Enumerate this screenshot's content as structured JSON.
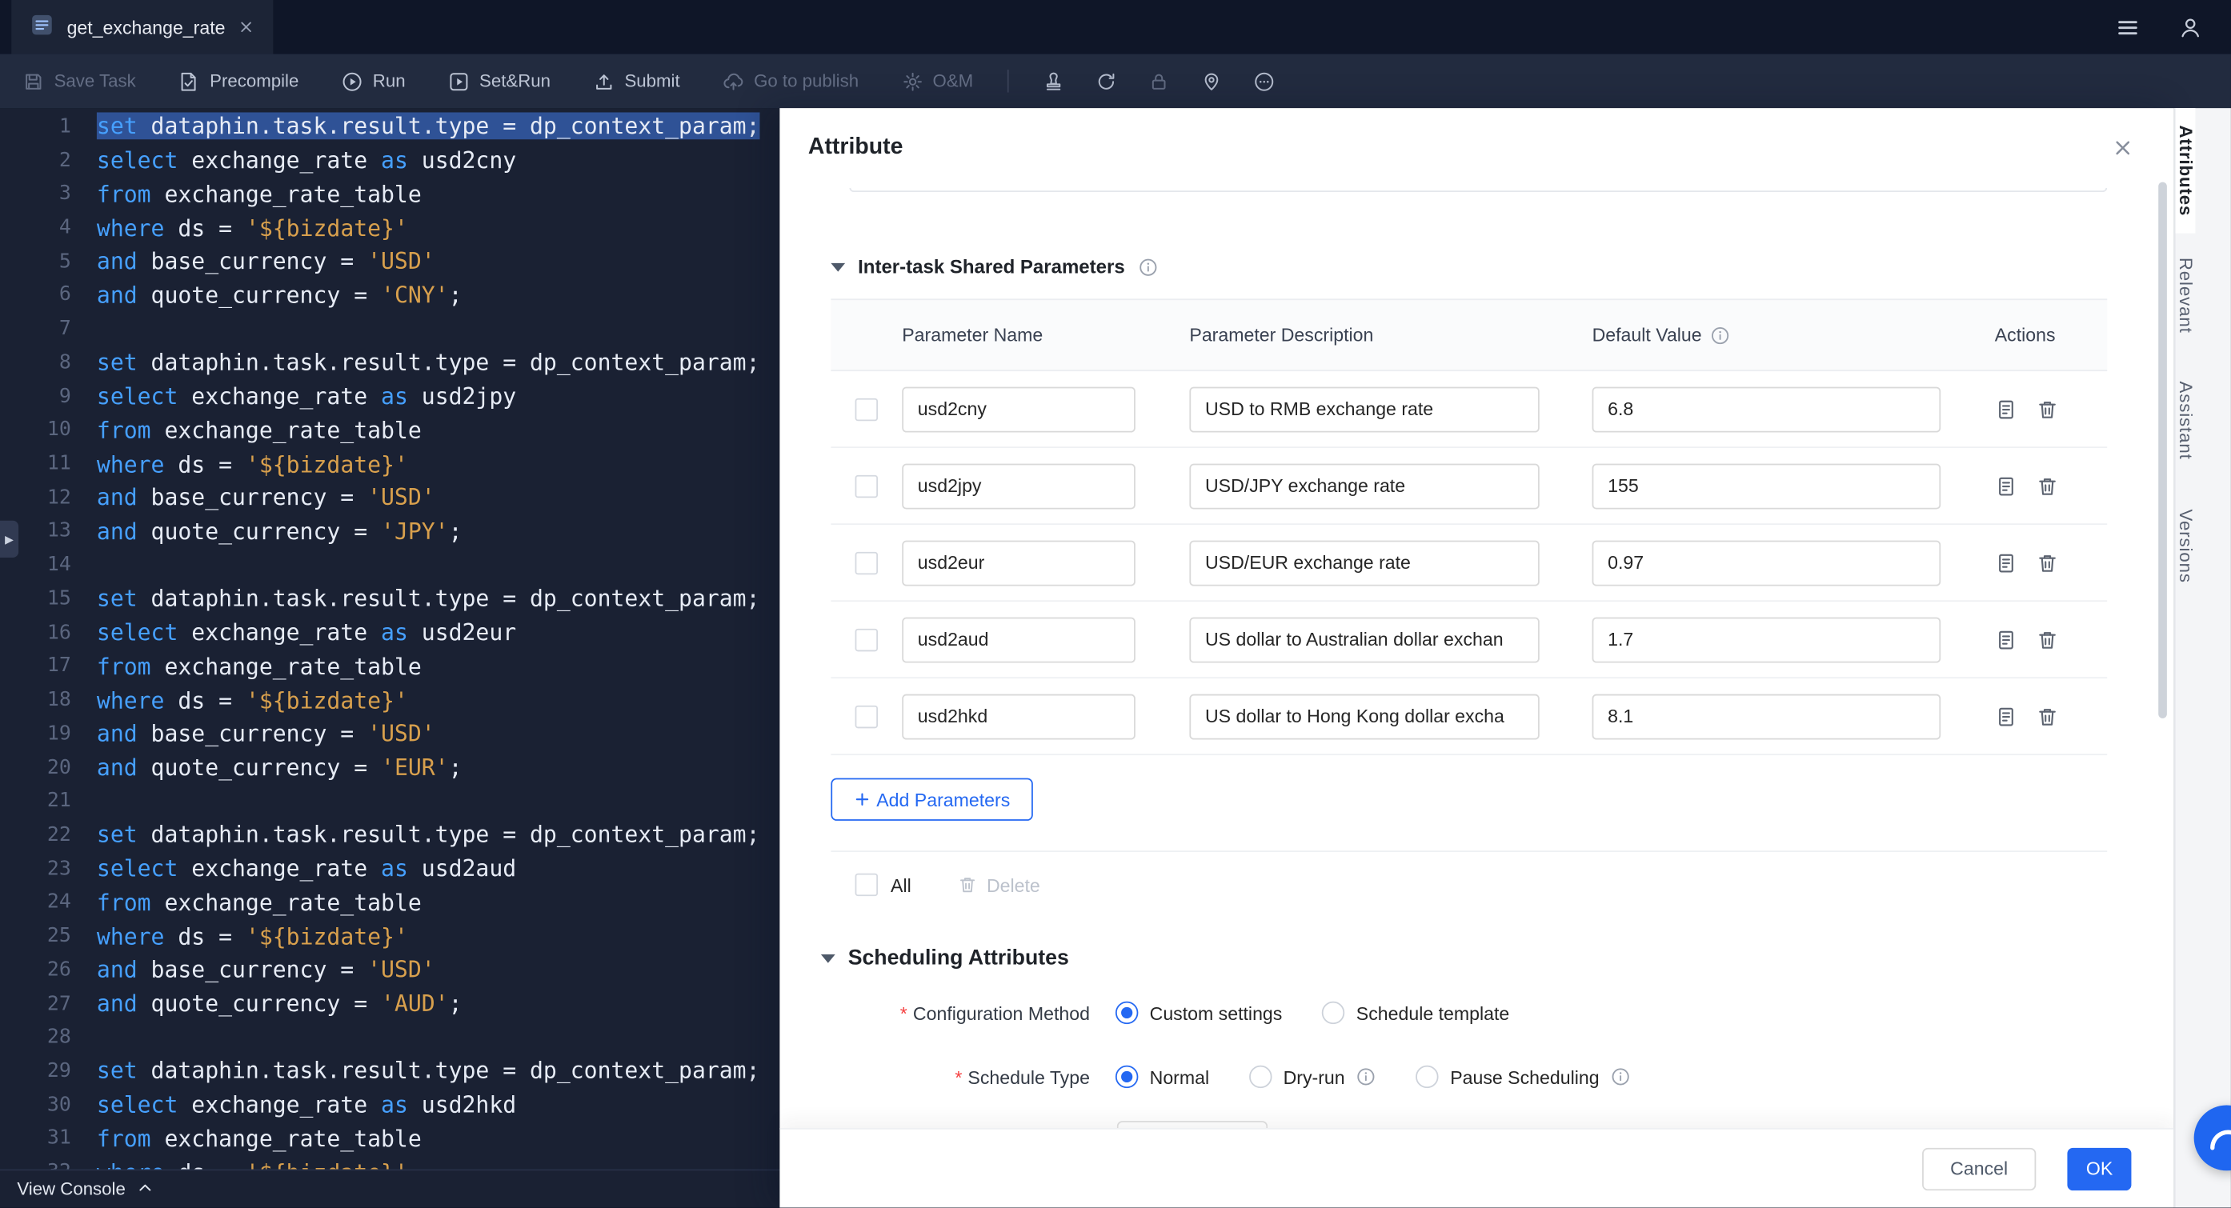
{
  "colors": {
    "accent_blue": "#2468f2",
    "editor_bg": "#1a2133",
    "keyword": "#46a0ff",
    "string": "#d8a04d",
    "selection": "#2f5296",
    "danger": "#f53f3f"
  },
  "tab_bar": {
    "active_tab": "get_exchange_rate"
  },
  "toolbar": {
    "actions": [
      {
        "label": "Save Task",
        "icon": "save-icon",
        "disabled": true
      },
      {
        "label": "Precompile",
        "icon": "precompile-icon",
        "disabled": false
      },
      {
        "label": "Run",
        "icon": "run-icon",
        "disabled": false
      },
      {
        "label": "Set&Run",
        "icon": "set-run-icon",
        "disabled": false
      },
      {
        "label": "Submit",
        "icon": "submit-icon",
        "disabled": false
      },
      {
        "label": "Go to publish",
        "icon": "publish-icon",
        "disabled": true
      },
      {
        "label": "O&M",
        "icon": "om-icon",
        "disabled": true
      }
    ],
    "icon_buttons": [
      {
        "icon": "stamp-icon",
        "disabled": false
      },
      {
        "icon": "refresh-icon",
        "disabled": false
      },
      {
        "icon": "lock-icon",
        "disabled": true
      },
      {
        "icon": "location-icon",
        "disabled": false
      },
      {
        "icon": "more-icon",
        "disabled": false
      }
    ]
  },
  "editor": {
    "console_label": "View Console",
    "lines": [
      {
        "sel": true,
        "t": [
          [
            "k",
            "set "
          ],
          [
            "p",
            "dataphin.task.result.type = dp_context_param;"
          ]
        ]
      },
      {
        "t": [
          [
            "k",
            "select "
          ],
          [
            "p",
            "exchange_rate "
          ],
          [
            "k",
            "as "
          ],
          [
            "p",
            "usd2cny"
          ]
        ]
      },
      {
        "t": [
          [
            "k",
            "from "
          ],
          [
            "p",
            "exchange_rate_table"
          ]
        ]
      },
      {
        "t": [
          [
            "k",
            "where "
          ],
          [
            "p",
            "ds = "
          ],
          [
            "s",
            "'${bizdate}'"
          ]
        ]
      },
      {
        "t": [
          [
            "k",
            "and "
          ],
          [
            "p",
            "base_currency = "
          ],
          [
            "s",
            "'USD'"
          ]
        ]
      },
      {
        "t": [
          [
            "k",
            "and "
          ],
          [
            "p",
            "quote_currency = "
          ],
          [
            "s",
            "'CNY'"
          ],
          [
            "p",
            ";"
          ]
        ]
      },
      {
        "t": []
      },
      {
        "t": [
          [
            "k",
            "set "
          ],
          [
            "p",
            "dataphin.task.result.type = dp_context_param;"
          ]
        ]
      },
      {
        "t": [
          [
            "k",
            "select "
          ],
          [
            "p",
            "exchange_rate "
          ],
          [
            "k",
            "as "
          ],
          [
            "p",
            "usd2jpy"
          ]
        ]
      },
      {
        "t": [
          [
            "k",
            "from "
          ],
          [
            "p",
            "exchange_rate_table"
          ]
        ]
      },
      {
        "t": [
          [
            "k",
            "where "
          ],
          [
            "p",
            "ds = "
          ],
          [
            "s",
            "'${bizdate}'"
          ]
        ]
      },
      {
        "t": [
          [
            "k",
            "and "
          ],
          [
            "p",
            "base_currency = "
          ],
          [
            "s",
            "'USD'"
          ]
        ]
      },
      {
        "t": [
          [
            "k",
            "and "
          ],
          [
            "p",
            "quote_currency = "
          ],
          [
            "s",
            "'JPY'"
          ],
          [
            "p",
            ";"
          ]
        ]
      },
      {
        "t": []
      },
      {
        "t": [
          [
            "k",
            "set "
          ],
          [
            "p",
            "dataphin.task.result.type = dp_context_param;"
          ]
        ]
      },
      {
        "t": [
          [
            "k",
            "select "
          ],
          [
            "p",
            "exchange_rate "
          ],
          [
            "k",
            "as "
          ],
          [
            "p",
            "usd2eur"
          ]
        ]
      },
      {
        "t": [
          [
            "k",
            "from "
          ],
          [
            "p",
            "exchange_rate_table"
          ]
        ]
      },
      {
        "t": [
          [
            "k",
            "where "
          ],
          [
            "p",
            "ds = "
          ],
          [
            "s",
            "'${bizdate}'"
          ]
        ]
      },
      {
        "t": [
          [
            "k",
            "and "
          ],
          [
            "p",
            "base_currency = "
          ],
          [
            "s",
            "'USD'"
          ]
        ]
      },
      {
        "t": [
          [
            "k",
            "and "
          ],
          [
            "p",
            "quote_currency = "
          ],
          [
            "s",
            "'EUR'"
          ],
          [
            "p",
            ";"
          ]
        ]
      },
      {
        "t": []
      },
      {
        "t": [
          [
            "k",
            "set "
          ],
          [
            "p",
            "dataphin.task.result.type = dp_context_param;"
          ]
        ]
      },
      {
        "t": [
          [
            "k",
            "select "
          ],
          [
            "p",
            "exchange_rate "
          ],
          [
            "k",
            "as "
          ],
          [
            "p",
            "usd2aud"
          ]
        ]
      },
      {
        "t": [
          [
            "k",
            "from "
          ],
          [
            "p",
            "exchange_rate_table"
          ]
        ]
      },
      {
        "t": [
          [
            "k",
            "where "
          ],
          [
            "p",
            "ds = "
          ],
          [
            "s",
            "'${bizdate}'"
          ]
        ]
      },
      {
        "t": [
          [
            "k",
            "and "
          ],
          [
            "p",
            "base_currency = "
          ],
          [
            "s",
            "'USD'"
          ]
        ]
      },
      {
        "t": [
          [
            "k",
            "and "
          ],
          [
            "p",
            "quote_currency = "
          ],
          [
            "s",
            "'AUD'"
          ],
          [
            "p",
            ";"
          ]
        ]
      },
      {
        "t": []
      },
      {
        "t": [
          [
            "k",
            "set "
          ],
          [
            "p",
            "dataphin.task.result.type = dp_context_param;"
          ]
        ]
      },
      {
        "t": [
          [
            "k",
            "select "
          ],
          [
            "p",
            "exchange_rate "
          ],
          [
            "k",
            "as "
          ],
          [
            "p",
            "usd2hkd"
          ]
        ]
      },
      {
        "t": [
          [
            "k",
            "from "
          ],
          [
            "p",
            "exchange_rate_table"
          ]
        ]
      },
      {
        "t": [
          [
            "k",
            "where "
          ],
          [
            "p",
            "ds = "
          ],
          [
            "s",
            "'${bizdate}'"
          ]
        ]
      }
    ]
  },
  "attribute_panel": {
    "title": "Attribute",
    "shared_params": {
      "title": "Inter-task Shared Parameters",
      "headers": [
        "Parameter Name",
        "Parameter Description",
        "Default Value",
        "Actions"
      ],
      "rows": [
        {
          "name": "usd2cny",
          "description": "USD to RMB exchange rate",
          "default_value": "6.8"
        },
        {
          "name": "usd2jpy",
          "description": "USD/JPY exchange rate",
          "default_value": "155"
        },
        {
          "name": "usd2eur",
          "description": "USD/EUR exchange rate",
          "default_value": "0.97"
        },
        {
          "name": "usd2aud",
          "description": "US dollar to Australian dollar exchan",
          "default_value": "1.7"
        },
        {
          "name": "usd2hkd",
          "description": "US dollar to Hong Kong dollar excha",
          "default_value": "8.1"
        }
      ],
      "add_button_label": "Add Parameters",
      "select_all_label": "All",
      "delete_label": "Delete"
    },
    "scheduling": {
      "title": "Scheduling Attributes",
      "config_method": {
        "label": "Configuration Method",
        "required": true,
        "options": [
          {
            "label": "Custom settings",
            "selected": true
          },
          {
            "label": "Schedule template",
            "selected": false
          }
        ]
      },
      "schedule_type": {
        "label": "Schedule Type",
        "required": true,
        "options": [
          {
            "label": "Normal",
            "selected": true
          },
          {
            "label": "Dry-run",
            "selected": false,
            "info": true
          },
          {
            "label": "Pause Scheduling",
            "selected": false,
            "info": true
          }
        ]
      }
    },
    "footer": {
      "cancel_label": "Cancel",
      "ok_label": "OK"
    }
  },
  "right_tabs": {
    "items": [
      {
        "label": "Attributes",
        "active": true
      },
      {
        "label": "Relevant",
        "active": false
      },
      {
        "label": "Assistant",
        "active": false
      },
      {
        "label": "Versions",
        "active": false
      }
    ]
  }
}
